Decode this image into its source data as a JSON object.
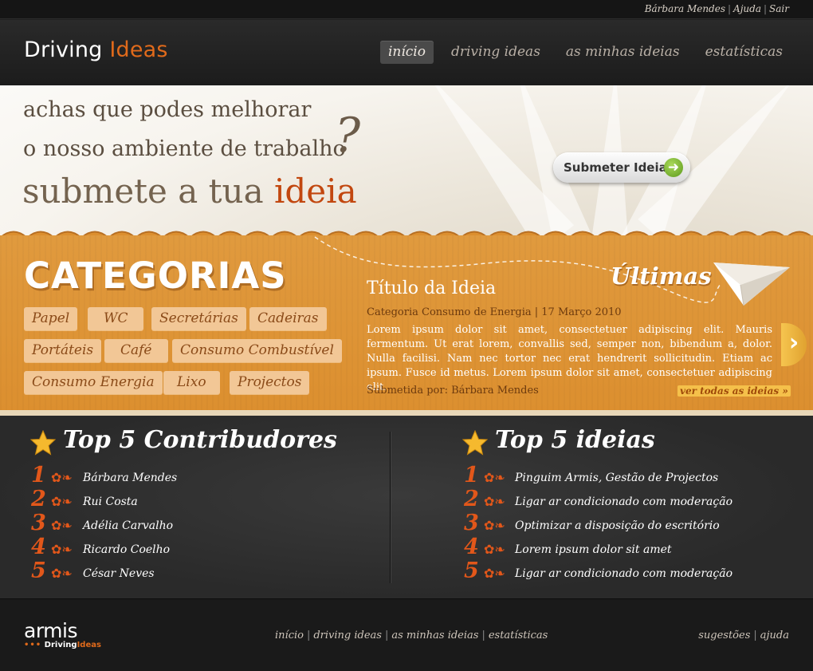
{
  "topbar": {
    "user_name": "Bárbara Mendes",
    "help_link": "Ajuda",
    "logout_link": "Sair"
  },
  "header": {
    "logo_part1": "Driving",
    "logo_part2": "Ideas",
    "nav": [
      {
        "label": "início",
        "active": true
      },
      {
        "label": "driving ideas",
        "active": false
      },
      {
        "label": "as minhas ideias",
        "active": false
      },
      {
        "label": "estatísticas",
        "active": false
      }
    ]
  },
  "hero": {
    "line1": "achas que podes melhorar",
    "line2": "o nosso ambiente de trabalho",
    "question_mark": "?",
    "line3_part1": "submete a tua",
    "line3_part2": "ideia",
    "submit_button": "Submeter Ideia",
    "submit_icon": "arrow-right-icon"
  },
  "categories": {
    "title": "CATEGORIAS",
    "tags": [
      "Papel",
      "WC",
      "Secretárias",
      "Cadeiras",
      "Portáteis",
      "Café",
      "Consumo Combustível",
      "Consumo Energia",
      "Lixo",
      "Projectos"
    ]
  },
  "latest": {
    "heading": "Últimas",
    "idea_title": "Título da Ideia",
    "idea_meta": "Categoria Consumo de Energia | 17 Março 2010",
    "idea_body": "Lorem ipsum dolor sit amet, consectetuer adipiscing elit. Mauris fermentum. Ut erat lorem, convallis sed, semper non, bibendum a, dolor. Nulla facilisi. Nam nec tortor nec erat hendrerit sollicitudin. Etiam ac ipsum. Fusce id metus. Lorem ipsum dolor sit amet, consectetuer adipiscing elit.",
    "submitted_by": "Submetida por: Bárbara Mendes",
    "see_all": "ver todas as ideias »",
    "next_arrow": "›"
  },
  "top_contributors": {
    "title": "Top 5 Contribudores",
    "items": [
      {
        "rank": "1",
        "name": "Bárbara Mendes"
      },
      {
        "rank": "2",
        "name": "Rui Costa"
      },
      {
        "rank": "3",
        "name": "Adélia Carvalho"
      },
      {
        "rank": "4",
        "name": "Ricardo Coelho"
      },
      {
        "rank": "5",
        "name": "César Neves"
      }
    ]
  },
  "top_ideas": {
    "title": "Top 5 ideias",
    "items": [
      {
        "rank": "1",
        "name": "Pinguim Armis, Gestão de Projectos"
      },
      {
        "rank": "2",
        "name": "Ligar ar condicionado com moderação"
      },
      {
        "rank": "3",
        "name": "Optimizar a disposição do escritório"
      },
      {
        "rank": "4",
        "name": "Lorem ipsum dolor sit amet"
      },
      {
        "rank": "5",
        "name": "Ligar ar condicionado com moderação"
      }
    ]
  },
  "footer": {
    "logo_top": "armis",
    "logo_dots": "•••",
    "logo_bottom1": "Driving",
    "logo_bottom2": "Ideas",
    "nav": [
      "início",
      "driving ideas",
      "as minhas ideias",
      "estatísticas"
    ],
    "right_links": [
      "sugestões",
      "ajuda"
    ]
  },
  "colors": {
    "accent": "#e06a1b",
    "band": "#dc8f2f",
    "dark": "#2a2a2a"
  }
}
